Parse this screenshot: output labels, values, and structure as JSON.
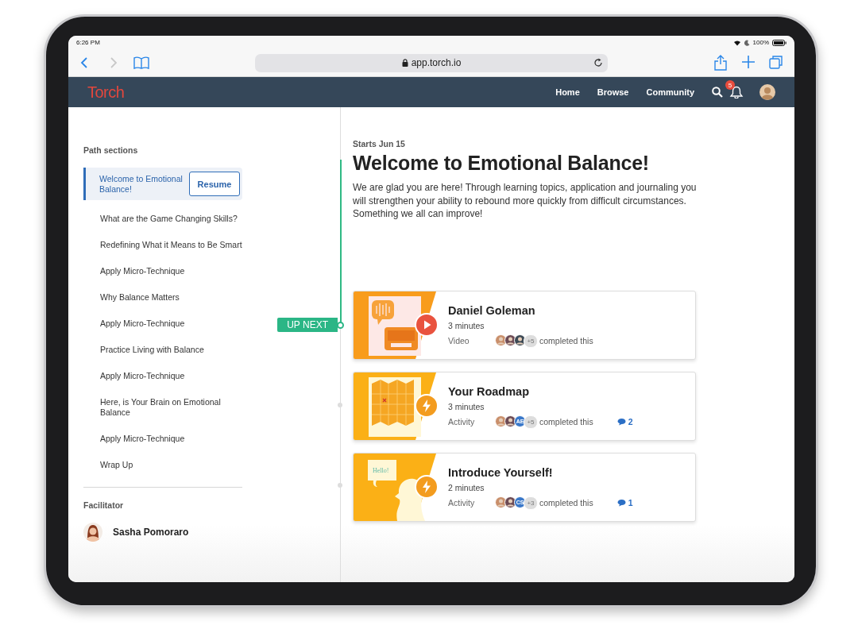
{
  "status_bar": {
    "time": "6:26 PM",
    "battery": "100%"
  },
  "browser": {
    "nav_buttons": [
      {
        "kind": "back",
        "disabled": false
      },
      {
        "kind": "forward",
        "disabled": true
      }
    ],
    "url": "app.torch.io"
  },
  "nav": {
    "logo": "Torch",
    "links": [
      "Home",
      "Browse",
      "Community"
    ],
    "notifications": "5"
  },
  "sidebar": {
    "heading": "Path sections",
    "items": [
      {
        "label": "Welcome to Emotional Balance!",
        "selected": true,
        "action": "Resume"
      },
      {
        "label": "What are the Game Changing Skills?",
        "selected": false
      },
      {
        "label": "Redefining What it Means to Be Smart",
        "selected": false
      },
      {
        "label": "Apply Micro-Technique",
        "selected": false
      },
      {
        "label": "Why Balance Matters",
        "selected": false
      },
      {
        "label": "Apply Micro-Technique",
        "selected": false
      },
      {
        "label": "Practice Living with Balance",
        "selected": false
      },
      {
        "label": "Apply Micro-Technique",
        "selected": false
      },
      {
        "label": "Here, is Your Brain on Emotional Balance",
        "selected": false
      },
      {
        "label": "Apply Micro-Technique",
        "selected": false
      },
      {
        "label": "Wrap Up",
        "selected": false
      }
    ],
    "facilitator_heading": "Facilitator",
    "facilitator": "Sasha Pomoraro"
  },
  "main": {
    "date": "Starts Jun 15",
    "title": "Welcome to Emotional Balance!",
    "intro": "We are glad you are here! Through learning topics, application and journaling you will strengthen your ability to rebound more quickly from difficult circumstances. Something we all can improve!",
    "up_next": "UP NEXT",
    "cards": [
      {
        "title": "Daniel Goleman",
        "duration": "3 minutes",
        "type": "Video",
        "kind": "video",
        "illustration": {
          "kind": "radio"
        },
        "avatars": [
          {
            "kind": "photo"
          },
          {
            "kind": "photo"
          },
          {
            "kind": "photo"
          },
          {
            "kind": "count",
            "text": "+5"
          }
        ],
        "completed": "completed this"
      },
      {
        "title": "Your Roadmap",
        "duration": "3 minutes",
        "type": "Activity",
        "kind": "activity",
        "illustration": {
          "kind": "map"
        },
        "avatars": [
          {
            "kind": "photo"
          },
          {
            "kind": "photo"
          },
          {
            "kind": "initials",
            "text": "AE"
          },
          {
            "kind": "count",
            "text": "+5"
          }
        ],
        "completed": "completed this",
        "comments": "2"
      },
      {
        "title": "Introduce Yourself!",
        "duration": "2 minutes",
        "type": "Activity",
        "kind": "activity",
        "illustration": {
          "kind": "speech",
          "text": "Hello!"
        },
        "avatars": [
          {
            "kind": "photo"
          },
          {
            "kind": "photo"
          },
          {
            "kind": "initials",
            "text": "CS"
          },
          {
            "kind": "count",
            "text": "+3"
          }
        ],
        "completed": "completed this",
        "comments": "1"
      }
    ]
  }
}
